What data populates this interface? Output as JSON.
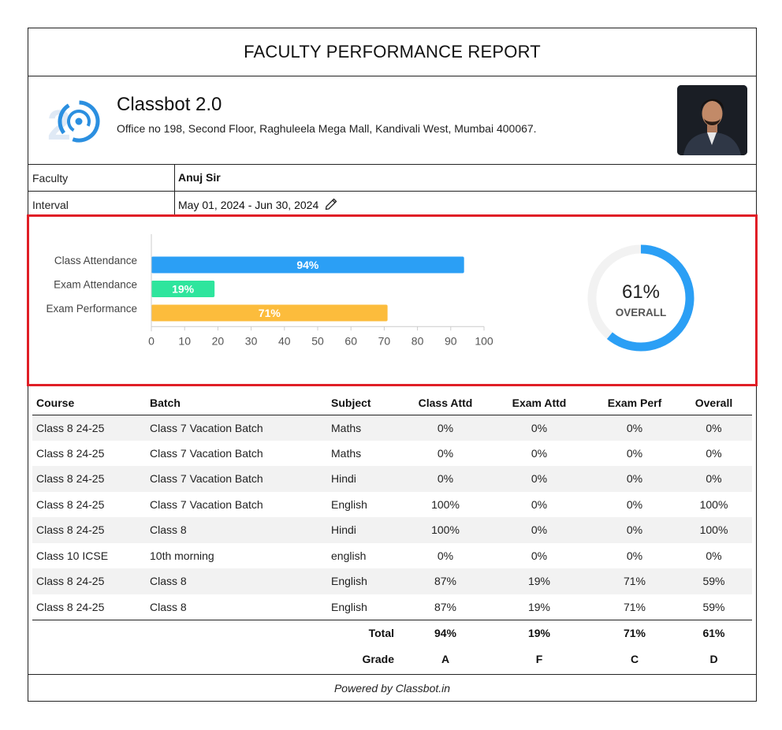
{
  "report": {
    "title": "FACULTY PERFORMANCE REPORT",
    "org_name": "Classbot 2.0",
    "org_address": "Office no 198, Second Floor, Raghuleela Mega Mall, Kandivali West, Mumbai 400067.",
    "faculty_label": "Faculty",
    "faculty_value": "Anuj Sir",
    "interval_label": "Interval",
    "interval_value": "May 01, 2024 - Jun 30, 2024",
    "footer": "Powered by Classbot.in",
    "icons": [
      "logo-icon",
      "pencil-icon",
      "avatar-photo"
    ]
  },
  "chart_data": [
    {
      "type": "bar",
      "orientation": "horizontal",
      "categories": [
        "Class Attendance",
        "Exam Attendance",
        "Exam Performance"
      ],
      "values": [
        94,
        19,
        71
      ],
      "data_labels": [
        "94%",
        "19%",
        "71%"
      ],
      "colors": [
        "#2b9ff5",
        "#2ee59d",
        "#fcbc3c"
      ],
      "xlim": [
        0,
        100
      ],
      "xticks": [
        0,
        10,
        20,
        30,
        40,
        50,
        60,
        70,
        80,
        90,
        100
      ],
      "grid": false
    },
    {
      "type": "pie",
      "style": "donut",
      "value": 61,
      "center_value": "61%",
      "center_label": "OVERALL",
      "colors": [
        "#2b9ff5",
        "#f2f2f2"
      ]
    }
  ],
  "table": {
    "headers": [
      "Course",
      "Batch",
      "Subject",
      "Class Attd",
      "Exam Attd",
      "Exam Perf",
      "Overall"
    ],
    "rows": [
      [
        "Class 8 24-25",
        "Class 7 Vacation Batch",
        "Maths",
        "0%",
        "0%",
        "0%",
        "0%"
      ],
      [
        "Class 8 24-25",
        "Class 7 Vacation Batch",
        "Maths",
        "0%",
        "0%",
        "0%",
        "0%"
      ],
      [
        "Class 8 24-25",
        "Class 7 Vacation Batch",
        "Hindi",
        "0%",
        "0%",
        "0%",
        "0%"
      ],
      [
        "Class 8 24-25",
        "Class 7 Vacation Batch",
        "English",
        "100%",
        "0%",
        "0%",
        "100%"
      ],
      [
        "Class 8 24-25",
        "Class 8",
        "Hindi",
        "100%",
        "0%",
        "0%",
        "100%"
      ],
      [
        "Class 10 ICSE",
        "10th morning",
        "english",
        "0%",
        "0%",
        "0%",
        "0%"
      ],
      [
        "Class 8 24-25",
        "Class 8",
        "English",
        "87%",
        "19%",
        "71%",
        "59%"
      ],
      [
        "Class 8 24-25",
        "Class 8",
        "English",
        "87%",
        "19%",
        "71%",
        "59%"
      ]
    ],
    "total": {
      "label": "Total",
      "values": [
        "94%",
        "19%",
        "71%",
        "61%"
      ]
    },
    "grade": {
      "label": "Grade",
      "values": [
        "A",
        "F",
        "C",
        "D"
      ]
    }
  }
}
